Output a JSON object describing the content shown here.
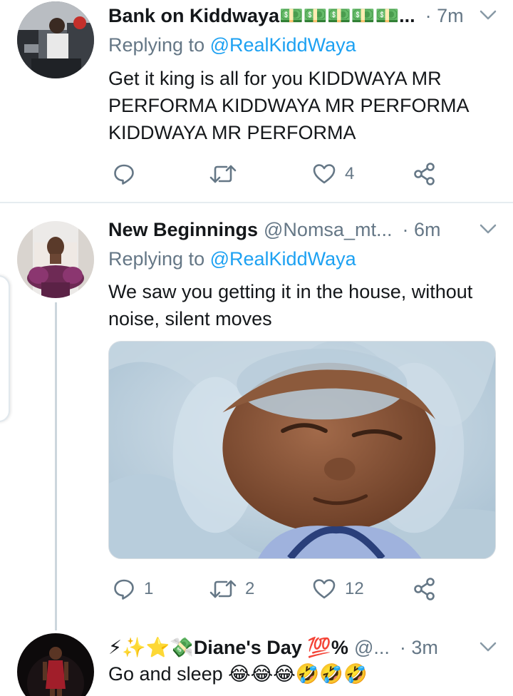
{
  "tweets": [
    {
      "author_name": "Bank on Kiddwaya💵💵💵💵💵...",
      "author_handle": "",
      "time": "· 7m",
      "replying_prefix": "Replying to",
      "replying_handle": "@RealKiddWaya",
      "text": "Get it king is all for you KIDDWAYA MR PERFORMA KIDDWAYA MR PERFORMA KIDDWAYA MR PERFORMA",
      "replies": "",
      "retweets": "",
      "likes": "4"
    },
    {
      "author_name": "New Beginnings",
      "author_handle": "@Nomsa_mt...",
      "time": "· 6m",
      "replying_prefix": "Replying to",
      "replying_handle": "@RealKiddWaya",
      "text": "We saw you getting it in the house, without noise, silent moves",
      "has_media": true,
      "replies": "1",
      "retweets": "2",
      "likes": "12"
    },
    {
      "author_name": "⚡✨⭐💸Diane's Day 💯%",
      "author_handle": "@...",
      "time": "· 3m",
      "text": "Go and sleep 😂😂😂🤣🤣🤣"
    }
  ],
  "colors": {
    "secondary_text": "#657786",
    "link": "#1da1f2",
    "divider": "#e6ecf0",
    "thread_line": "#ccd6dd"
  },
  "icons": [
    "chevron-down-icon",
    "reply-icon",
    "retweet-icon",
    "like-icon",
    "share-icon"
  ]
}
